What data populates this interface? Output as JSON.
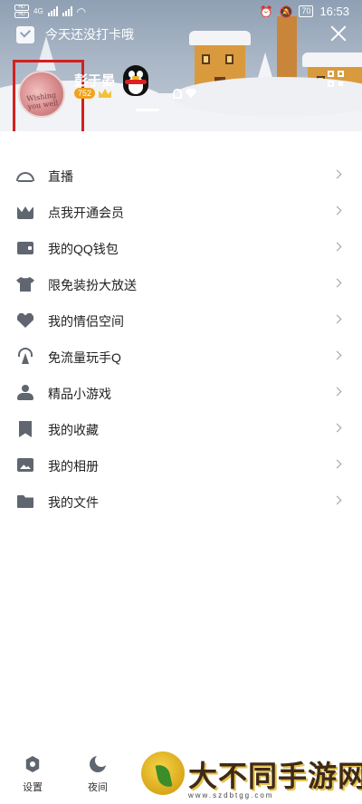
{
  "status_bar": {
    "left_badges": [
      "HD",
      "HD"
    ],
    "network_label": "4G",
    "battery": "70",
    "time": "16:53"
  },
  "header": {
    "checkin_text": "今天还没打卡哦",
    "nickname": "彭于晏",
    "level": "752",
    "avatar_text": "Wishing you well"
  },
  "menu": [
    {
      "label": "直播",
      "icon": "live-icon"
    },
    {
      "label": "点我开通会员",
      "icon": "vip-crown-icon"
    },
    {
      "label": "我的QQ钱包",
      "icon": "wallet-icon"
    },
    {
      "label": "限免装扮大放送",
      "icon": "shirt-icon"
    },
    {
      "label": "我的情侣空间",
      "icon": "heart-icon"
    },
    {
      "label": "免流量玩手Q",
      "icon": "antenna-icon"
    },
    {
      "label": "精品小游戏",
      "icon": "game-icon"
    },
    {
      "label": "我的收藏",
      "icon": "bookmark-icon"
    },
    {
      "label": "我的相册",
      "icon": "photo-icon"
    },
    {
      "label": "我的文件",
      "icon": "folder-icon"
    }
  ],
  "bottom_bar": {
    "settings_label": "设置",
    "night_label": "夜间"
  },
  "watermark": {
    "title": "大不同手游网",
    "url": "www.szdbtgg.com"
  },
  "colors": {
    "highlight_box": "#d32020",
    "icon_gray": "#5f6670",
    "header_sky": "#a9b6c6"
  }
}
